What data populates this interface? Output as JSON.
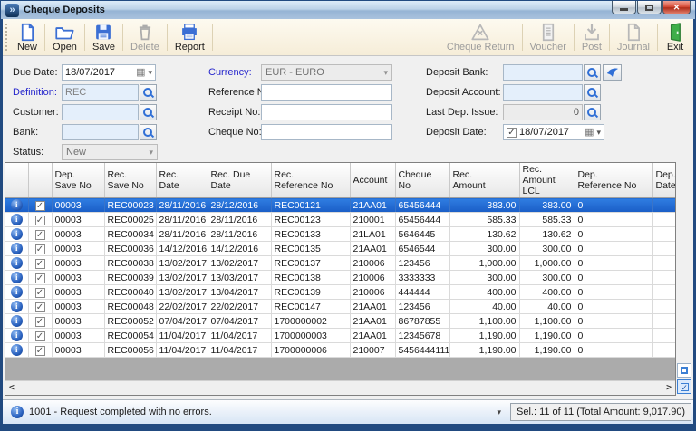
{
  "window": {
    "title": "Cheque Deposits"
  },
  "toolbar": {
    "new": "New",
    "open": "Open",
    "save": "Save",
    "delete": "Delete",
    "report": "Report",
    "cheque_return": "Cheque Return",
    "voucher": "Voucher",
    "post": "Post",
    "journal": "Journal",
    "exit": "Exit"
  },
  "form": {
    "due_date": {
      "label": "Due Date:",
      "value": "18/07/2017"
    },
    "definition": {
      "label": "Definition:",
      "value": "REC"
    },
    "customer": {
      "label": "Customer:",
      "value": ""
    },
    "bank": {
      "label": "Bank:",
      "value": ""
    },
    "status": {
      "label": "Status:",
      "value": "New"
    },
    "currency": {
      "label": "Currency:",
      "value": "EUR - EURO"
    },
    "reference_no": {
      "label": "Reference No:",
      "value": ""
    },
    "receipt_no": {
      "label": "Receipt No:",
      "value": ""
    },
    "cheque_no": {
      "label": "Cheque No:",
      "value": ""
    },
    "deposit_bank": {
      "label": "Deposit Bank:",
      "value": ""
    },
    "deposit_account": {
      "label": "Deposit Account:",
      "value": ""
    },
    "last_dep_issue": {
      "label": "Last Dep. Issue:",
      "value": "0"
    },
    "deposit_date": {
      "label": "Deposit Date:",
      "value": "18/07/2017",
      "checked": true
    }
  },
  "grid": {
    "columns": [
      {
        "line1": "",
        "line2": ""
      },
      {
        "line1": "",
        "line2": ""
      },
      {
        "line1": "Dep.",
        "line2": "Save No"
      },
      {
        "line1": "Rec.",
        "line2": "Save No"
      },
      {
        "line1": "Rec.",
        "line2": "Date"
      },
      {
        "line1": "Rec. Due",
        "line2": "Date"
      },
      {
        "line1": "Rec.",
        "line2": "Reference No"
      },
      {
        "line1": "Account",
        "line2": ""
      },
      {
        "line1": "Cheque",
        "line2": "No"
      },
      {
        "line1": "Rec.",
        "line2": "Amount"
      },
      {
        "line1": "Rec.",
        "line2": "Amount LCL"
      },
      {
        "line1": "Dep.",
        "line2": "Reference No"
      },
      {
        "line1": "Dep.",
        "line2": "Date"
      }
    ],
    "selected_row_index": 0,
    "rows": [
      {
        "checked": true,
        "cells": [
          "00003",
          "REC00023",
          "28/11/2016",
          "28/12/2016",
          "REC00121",
          "21AA01",
          "65456444",
          "383.00",
          "383.00",
          "0",
          ""
        ]
      },
      {
        "checked": true,
        "cells": [
          "00003",
          "REC00025",
          "28/11/2016",
          "28/11/2016",
          "REC00123",
          "210001",
          "65456444",
          "585.33",
          "585.33",
          "0",
          ""
        ]
      },
      {
        "checked": true,
        "cells": [
          "00003",
          "REC00034",
          "28/11/2016",
          "28/11/2016",
          "REC00133",
          "21LA01",
          "5646445",
          "130.62",
          "130.62",
          "0",
          ""
        ]
      },
      {
        "checked": true,
        "cells": [
          "00003",
          "REC00036",
          "14/12/2016",
          "14/12/2016",
          "REC00135",
          "21AA01",
          "6546544",
          "300.00",
          "300.00",
          "0",
          ""
        ]
      },
      {
        "checked": true,
        "cells": [
          "00003",
          "REC00038",
          "13/02/2017",
          "13/02/2017",
          "REC00137",
          "210006",
          "123456",
          "1,000.00",
          "1,000.00",
          "0",
          ""
        ]
      },
      {
        "checked": true,
        "cells": [
          "00003",
          "REC00039",
          "13/02/2017",
          "13/03/2017",
          "REC00138",
          "210006",
          "3333333",
          "300.00",
          "300.00",
          "0",
          ""
        ]
      },
      {
        "checked": true,
        "cells": [
          "00003",
          "REC00040",
          "13/02/2017",
          "13/04/2017",
          "REC00139",
          "210006",
          "444444",
          "400.00",
          "400.00",
          "0",
          ""
        ]
      },
      {
        "checked": true,
        "cells": [
          "00003",
          "REC00048",
          "22/02/2017",
          "22/02/2017",
          "REC00147",
          "21AA01",
          "123456",
          "40.00",
          "40.00",
          "0",
          ""
        ]
      },
      {
        "checked": true,
        "cells": [
          "00003",
          "REC00052",
          "07/04/2017",
          "07/04/2017",
          "1700000002",
          "21AA01",
          "86787855",
          "1,100.00",
          "1,100.00",
          "0",
          ""
        ]
      },
      {
        "checked": true,
        "cells": [
          "00003",
          "REC00054",
          "11/04/2017",
          "11/04/2017",
          "1700000003",
          "21AA01",
          "12345678",
          "1,190.00",
          "1,190.00",
          "0",
          ""
        ]
      },
      {
        "checked": true,
        "cells": [
          "00003",
          "REC00056",
          "11/04/2017",
          "11/04/2017",
          "1700000006",
          "210007",
          "5456444111",
          "1,190.00",
          "1,190.00",
          "0",
          ""
        ]
      }
    ]
  },
  "statusbar": {
    "message": "1001 -  Request completed with no errors.",
    "selection": "Sel.: 11 of 11 (Total Amount: 9,017.90)"
  },
  "colors": {
    "selection_blue": "#1e63c8",
    "link_label_blue": "#2626cc",
    "titlebar_blue": "#a9c2de",
    "toolbar_cream": "#f6edd8",
    "exit_green": "#3fae49"
  }
}
